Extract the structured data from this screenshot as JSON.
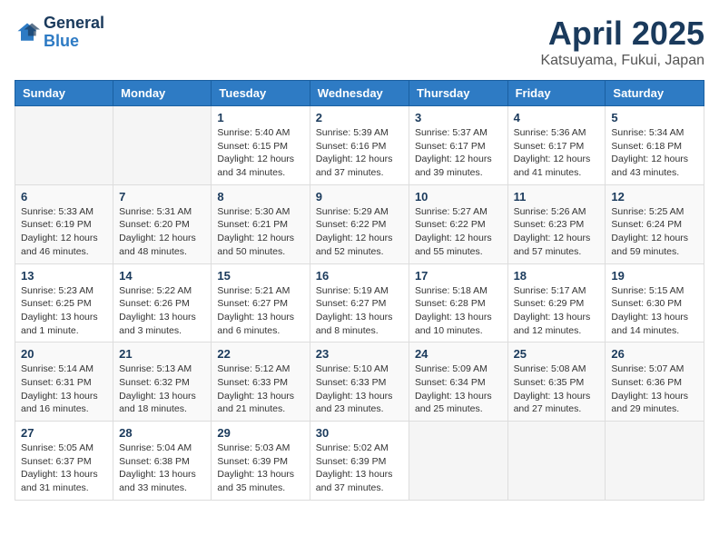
{
  "header": {
    "logo_general": "General",
    "logo_blue": "Blue",
    "month_title": "April 2025",
    "subtitle": "Katsuyama, Fukui, Japan"
  },
  "days_of_week": [
    "Sunday",
    "Monday",
    "Tuesday",
    "Wednesday",
    "Thursday",
    "Friday",
    "Saturday"
  ],
  "weeks": [
    [
      {
        "num": "",
        "info": ""
      },
      {
        "num": "",
        "info": ""
      },
      {
        "num": "1",
        "info": "Sunrise: 5:40 AM\nSunset: 6:15 PM\nDaylight: 12 hours and 34 minutes."
      },
      {
        "num": "2",
        "info": "Sunrise: 5:39 AM\nSunset: 6:16 PM\nDaylight: 12 hours and 37 minutes."
      },
      {
        "num": "3",
        "info": "Sunrise: 5:37 AM\nSunset: 6:17 PM\nDaylight: 12 hours and 39 minutes."
      },
      {
        "num": "4",
        "info": "Sunrise: 5:36 AM\nSunset: 6:17 PM\nDaylight: 12 hours and 41 minutes."
      },
      {
        "num": "5",
        "info": "Sunrise: 5:34 AM\nSunset: 6:18 PM\nDaylight: 12 hours and 43 minutes."
      }
    ],
    [
      {
        "num": "6",
        "info": "Sunrise: 5:33 AM\nSunset: 6:19 PM\nDaylight: 12 hours and 46 minutes."
      },
      {
        "num": "7",
        "info": "Sunrise: 5:31 AM\nSunset: 6:20 PM\nDaylight: 12 hours and 48 minutes."
      },
      {
        "num": "8",
        "info": "Sunrise: 5:30 AM\nSunset: 6:21 PM\nDaylight: 12 hours and 50 minutes."
      },
      {
        "num": "9",
        "info": "Sunrise: 5:29 AM\nSunset: 6:22 PM\nDaylight: 12 hours and 52 minutes."
      },
      {
        "num": "10",
        "info": "Sunrise: 5:27 AM\nSunset: 6:22 PM\nDaylight: 12 hours and 55 minutes."
      },
      {
        "num": "11",
        "info": "Sunrise: 5:26 AM\nSunset: 6:23 PM\nDaylight: 12 hours and 57 minutes."
      },
      {
        "num": "12",
        "info": "Sunrise: 5:25 AM\nSunset: 6:24 PM\nDaylight: 12 hours and 59 minutes."
      }
    ],
    [
      {
        "num": "13",
        "info": "Sunrise: 5:23 AM\nSunset: 6:25 PM\nDaylight: 13 hours and 1 minute."
      },
      {
        "num": "14",
        "info": "Sunrise: 5:22 AM\nSunset: 6:26 PM\nDaylight: 13 hours and 3 minutes."
      },
      {
        "num": "15",
        "info": "Sunrise: 5:21 AM\nSunset: 6:27 PM\nDaylight: 13 hours and 6 minutes."
      },
      {
        "num": "16",
        "info": "Sunrise: 5:19 AM\nSunset: 6:27 PM\nDaylight: 13 hours and 8 minutes."
      },
      {
        "num": "17",
        "info": "Sunrise: 5:18 AM\nSunset: 6:28 PM\nDaylight: 13 hours and 10 minutes."
      },
      {
        "num": "18",
        "info": "Sunrise: 5:17 AM\nSunset: 6:29 PM\nDaylight: 13 hours and 12 minutes."
      },
      {
        "num": "19",
        "info": "Sunrise: 5:15 AM\nSunset: 6:30 PM\nDaylight: 13 hours and 14 minutes."
      }
    ],
    [
      {
        "num": "20",
        "info": "Sunrise: 5:14 AM\nSunset: 6:31 PM\nDaylight: 13 hours and 16 minutes."
      },
      {
        "num": "21",
        "info": "Sunrise: 5:13 AM\nSunset: 6:32 PM\nDaylight: 13 hours and 18 minutes."
      },
      {
        "num": "22",
        "info": "Sunrise: 5:12 AM\nSunset: 6:33 PM\nDaylight: 13 hours and 21 minutes."
      },
      {
        "num": "23",
        "info": "Sunrise: 5:10 AM\nSunset: 6:33 PM\nDaylight: 13 hours and 23 minutes."
      },
      {
        "num": "24",
        "info": "Sunrise: 5:09 AM\nSunset: 6:34 PM\nDaylight: 13 hours and 25 minutes."
      },
      {
        "num": "25",
        "info": "Sunrise: 5:08 AM\nSunset: 6:35 PM\nDaylight: 13 hours and 27 minutes."
      },
      {
        "num": "26",
        "info": "Sunrise: 5:07 AM\nSunset: 6:36 PM\nDaylight: 13 hours and 29 minutes."
      }
    ],
    [
      {
        "num": "27",
        "info": "Sunrise: 5:05 AM\nSunset: 6:37 PM\nDaylight: 13 hours and 31 minutes."
      },
      {
        "num": "28",
        "info": "Sunrise: 5:04 AM\nSunset: 6:38 PM\nDaylight: 13 hours and 33 minutes."
      },
      {
        "num": "29",
        "info": "Sunrise: 5:03 AM\nSunset: 6:39 PM\nDaylight: 13 hours and 35 minutes."
      },
      {
        "num": "30",
        "info": "Sunrise: 5:02 AM\nSunset: 6:39 PM\nDaylight: 13 hours and 37 minutes."
      },
      {
        "num": "",
        "info": ""
      },
      {
        "num": "",
        "info": ""
      },
      {
        "num": "",
        "info": ""
      }
    ]
  ]
}
